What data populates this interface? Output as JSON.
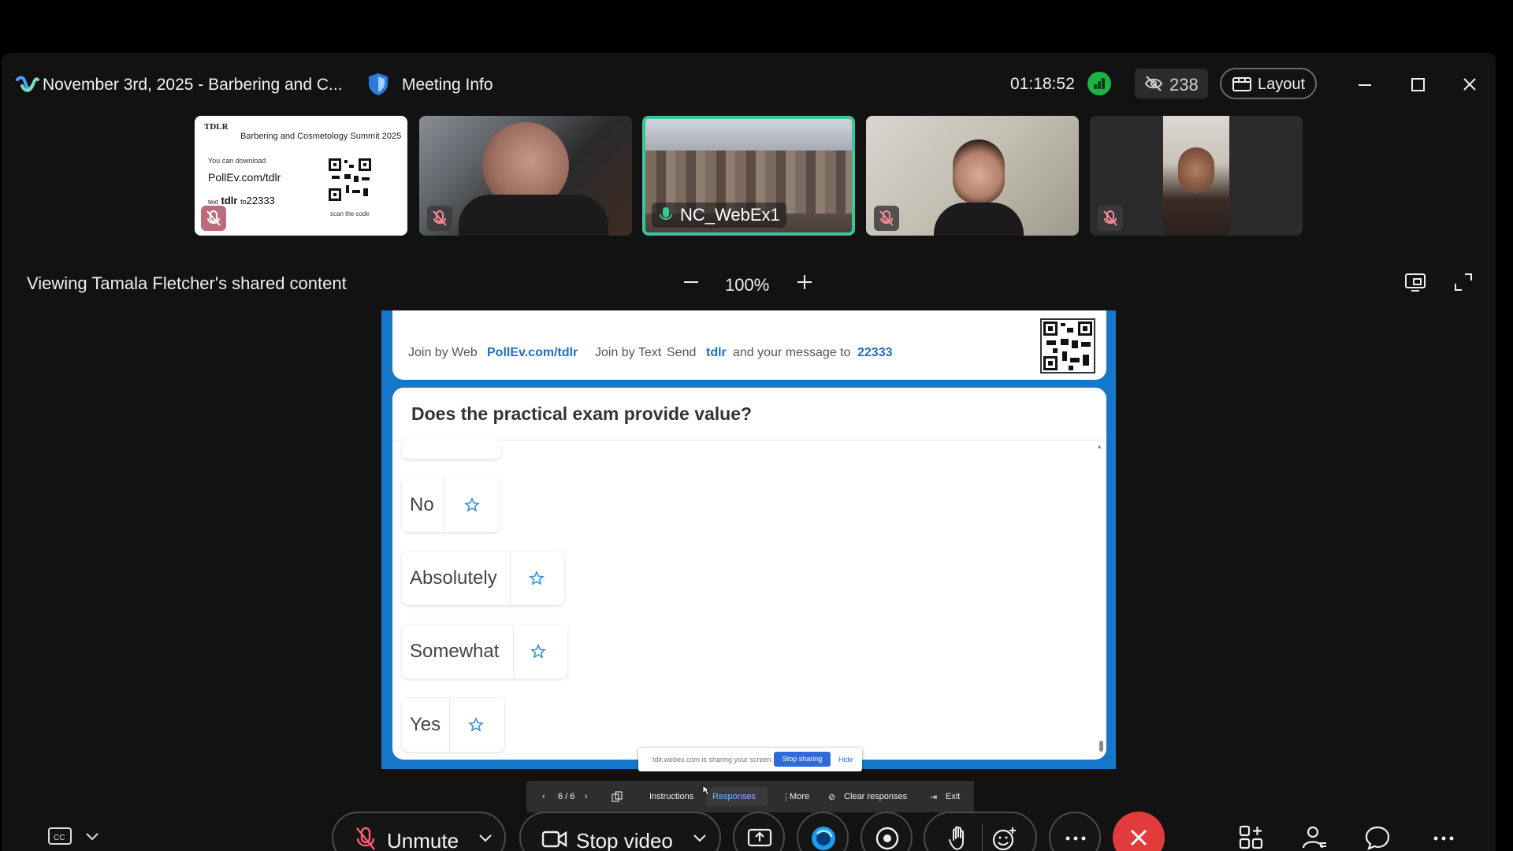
{
  "window": {
    "meeting_title": "November 3rd, 2025 - Barbering and C...",
    "meeting_info_label": "Meeting Info",
    "elapsed_time": "01:18:52",
    "hidden_participants_count": "238",
    "layout_label": "Layout"
  },
  "thumbnails": [
    {
      "type": "slide",
      "org": "TDLR",
      "title": "Barbering and Cosmetology Summit 2025",
      "download_text": "You can download",
      "url": "PollEv.com/tdlr",
      "text_prefix": "text",
      "text_code": "tdlr",
      "text_to": "to",
      "text_number": "22333",
      "scan_text": "scan the code",
      "muted": true
    },
    {
      "type": "participant",
      "muted": true
    },
    {
      "type": "participant",
      "label": "NC_WebEx1",
      "active": true,
      "muted": false
    },
    {
      "type": "participant",
      "muted": true
    },
    {
      "type": "participant",
      "muted": true
    }
  ],
  "viewing": {
    "label": "Viewing Tamala Fletcher's shared content",
    "zoom": "100%"
  },
  "slide": {
    "join_web_label": "Join by Web",
    "join_web_url": "PollEv.com/tdlr",
    "join_text_label": "Join by Text",
    "send_label": "Send",
    "send_code": "tdlr",
    "send_rest": "and your message to",
    "send_number": "22333",
    "question": "Does the practical exam provide value?",
    "answers": [
      "No",
      "Absolutely",
      "Somewhat",
      "Yes"
    ]
  },
  "sharing_notice": {
    "message": "tdlr.webex.com is sharing your screen.",
    "stop_label": "Stop sharing",
    "hide_label": "Hide"
  },
  "presenter_bar": {
    "page": "6 / 6",
    "instructions": "Instructions",
    "responses": "Responses",
    "more": "More",
    "clear": "Clear responses",
    "exit": "Exit"
  },
  "toolbar": {
    "unmute_label": "Unmute",
    "stop_video_label": "Stop video"
  },
  "colors": {
    "active_border": "#3cc59a",
    "poll_blue": "#1677c9",
    "end_red": "#e23b3b",
    "signal_green": "#1db446"
  }
}
